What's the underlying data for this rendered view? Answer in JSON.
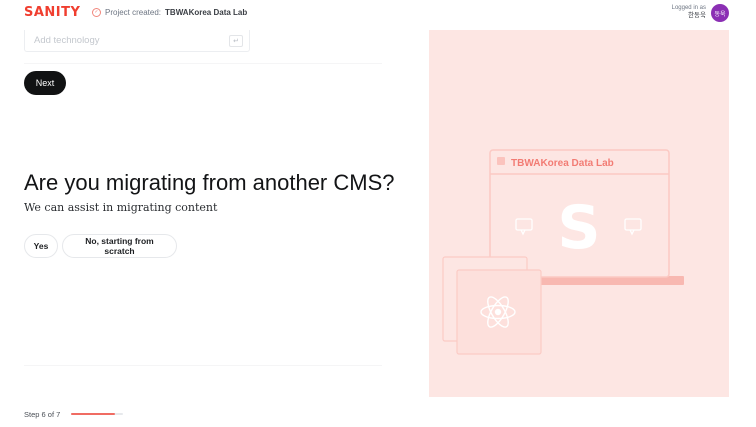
{
  "header": {
    "logo": "SANITY",
    "project_prefix": "Project created:",
    "project_name": "TBWAKorea Data Lab",
    "logged_in_label": "Logged in as",
    "user_name": "한동욱",
    "avatar_initials": "동욱"
  },
  "technology_input": {
    "placeholder": "Add technology",
    "value": "",
    "enter_glyph": "↵"
  },
  "next_button": "Next",
  "question": {
    "title": "Are you migrating from another CMS?",
    "subtitle": "We can assist in migrating content",
    "options": [
      "Yes",
      "No, starting from scratch"
    ]
  },
  "progress": {
    "label": "Step 6 of 7",
    "current": 6,
    "total": 7
  },
  "illustration": {
    "window_title": "TBWAKorea Data Lab",
    "big_letter": "S",
    "icons": [
      "comment-icon",
      "comment-icon",
      "react-icon"
    ]
  },
  "colors": {
    "brand": "#f03e2f",
    "illustration_bg": "#fde6e3",
    "avatar": "#8b2fb4",
    "progress": "#f06c63"
  }
}
